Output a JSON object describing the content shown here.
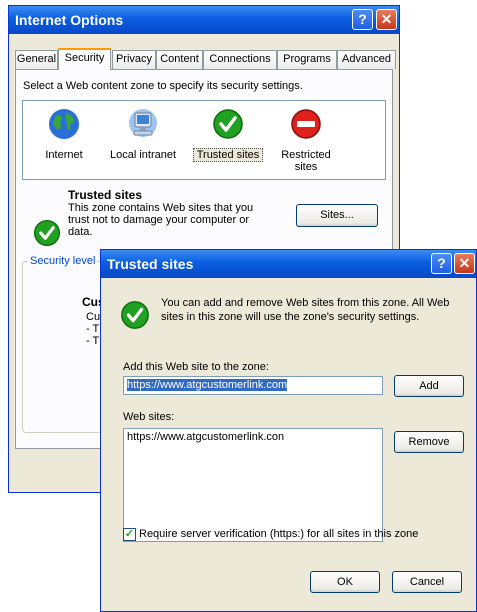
{
  "internet_options": {
    "title": "Internet Options",
    "tabs": [
      "General",
      "Security",
      "Privacy",
      "Content",
      "Connections",
      "Programs",
      "Advanced"
    ],
    "selected_tab": "Security",
    "zone_prompt": "Select a Web content zone to specify its security settings.",
    "zones": [
      {
        "label": "Internet",
        "icon": "globe-icon"
      },
      {
        "label": "Local intranet",
        "icon": "computer-icon"
      },
      {
        "label": "Trusted sites",
        "icon": "green-check-icon"
      },
      {
        "label": "Restricted sites",
        "icon": "red-stop-icon"
      }
    ],
    "selected_zone": "Trusted sites",
    "zone_title": "Trusted sites",
    "zone_desc": "This zone contains Web sites that you trust not to damage your computer or data.",
    "sites_button": "Sites...",
    "security_level_label": "Security level",
    "custom_title": "Cust",
    "custom_sub": "Cu",
    "custom_line1": "- T",
    "custom_line2": "- T"
  },
  "trusted_sites": {
    "title": "Trusted sites",
    "info": "You can add and remove Web sites from this zone. All Web sites in this zone will use the zone's security settings.",
    "add_label": "Add this Web site to the zone:",
    "add_value": "https://www.atgcustomerlink.com",
    "add_button": "Add",
    "websites_label": "Web sites:",
    "websites": [
      "https://www.atgcustomerlink.con"
    ],
    "remove_button": "Remove",
    "require_label": "Require server verification (https:) for all sites in this zone",
    "require_checked": true,
    "ok_button": "OK",
    "cancel_button": "Cancel"
  },
  "colors": {
    "titlebar": "#0a5ee0",
    "dialog_bg": "#ece9d8",
    "check_green": "#21a121",
    "stop_red": "#e0201c",
    "tab_highlight": "#ff9a00"
  }
}
